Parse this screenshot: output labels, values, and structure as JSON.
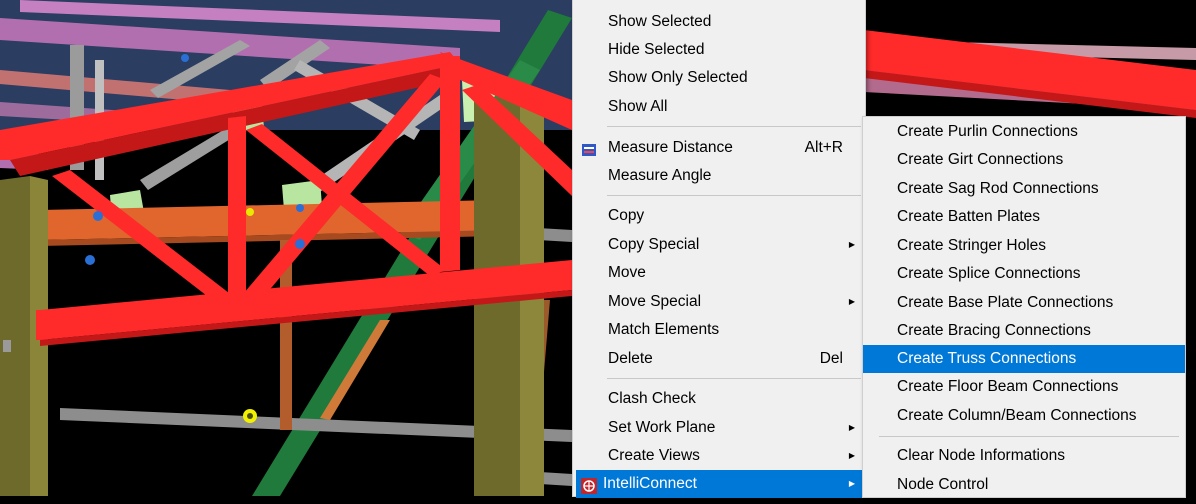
{
  "context_menu": {
    "items": [
      {
        "label": "Show Selected"
      },
      {
        "label": "Hide Selected"
      },
      {
        "label": "Show Only Selected"
      },
      {
        "label": "Show All"
      },
      {
        "label": "Measure Distance",
        "shortcut": "Alt+R",
        "icon": "measure-distance-icon"
      },
      {
        "label": "Measure Angle"
      },
      {
        "label": "Copy"
      },
      {
        "label": "Copy Special",
        "submenu": true
      },
      {
        "label": "Move"
      },
      {
        "label": "Move Special",
        "submenu": true
      },
      {
        "label": "Match Elements"
      },
      {
        "label": "Delete",
        "shortcut": "Del"
      },
      {
        "label": "Clash Check"
      },
      {
        "label": "Set Work Plane",
        "submenu": true
      },
      {
        "label": "Create Views",
        "submenu": true
      },
      {
        "label": "IntelliConnect",
        "submenu": true,
        "highlighted": true,
        "icon": "intelliconnect-icon"
      }
    ]
  },
  "submenu": {
    "items": [
      {
        "label": "Create Purlin Connections"
      },
      {
        "label": "Create Girt Connections"
      },
      {
        "label": "Create Sag Rod Connections"
      },
      {
        "label": "Create Batten Plates"
      },
      {
        "label": "Create Stringer Holes"
      },
      {
        "label": "Create Splice Connections"
      },
      {
        "label": "Create Base Plate Connections"
      },
      {
        "label": "Create Bracing Connections"
      },
      {
        "label": "Create Truss Connections",
        "highlighted": true
      },
      {
        "label": "Create Floor Beam Connections"
      },
      {
        "label": "Create Column/Beam Connections"
      },
      {
        "label": "Clear Node Informations"
      },
      {
        "label": "Node Control"
      }
    ]
  },
  "colors": {
    "menu_bg": "#f0f0f0",
    "highlight": "#0078d7",
    "truss_red": "#ff2a2a",
    "beam_orange": "#e0662e",
    "column_olive": "#6e6a2c",
    "purlin_purple": "#b96fb5",
    "diagonal_green": "#1f7a3c",
    "girt_gray": "#8a8a8a"
  }
}
